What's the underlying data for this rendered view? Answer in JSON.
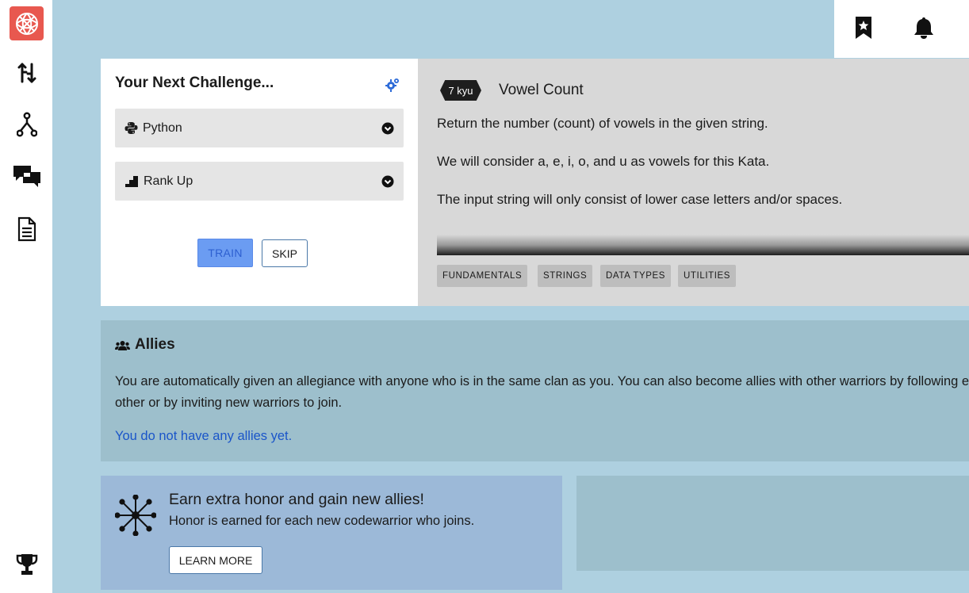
{
  "sidebar": {
    "logo": "codewars-logo",
    "items": [
      {
        "icon": "practice-swap-icon"
      },
      {
        "icon": "fork-icon"
      },
      {
        "icon": "discuss-chat-icon"
      },
      {
        "icon": "docs-document-icon"
      },
      {
        "icon": "leaderboard-trophy-icon"
      }
    ]
  },
  "topbar": {
    "icons": [
      "bookmark-star-icon",
      "bell-icon"
    ]
  },
  "challenge": {
    "heading": "Your Next Challenge...",
    "language_label": "Python",
    "strategy_label": "Rank Up",
    "train_label": "TRAIN",
    "skip_label": "SKIP",
    "kyu": "7 kyu",
    "title": "Vowel Count",
    "description": [
      "Return the number (count) of vowels in the given string.",
      "We will consider a, e, i, o, and u as vowels for this Kata.",
      "The input string will only consist of lower case letters and/or spaces."
    ],
    "tags": [
      "FUNDAMENTALS",
      "STRINGS",
      "DATA TYPES",
      "UTILITIES"
    ]
  },
  "allies": {
    "title": "Allies",
    "text": "You are automatically given an allegiance with anyone who is in the same clan as you. You can also become allies with other warriors by following each other or by inviting new warriors to join.",
    "empty": "You do not have any allies yet."
  },
  "honor": {
    "title": "Earn extra honor and gain new allies!",
    "subtitle": "Honor is earned for each new codewarrior who joins.",
    "button": "LEARN MORE"
  },
  "colors": {
    "background": "#aed0e0",
    "logo": "#e8584f",
    "link": "#1a55c9",
    "train": "#6b9cf2"
  }
}
